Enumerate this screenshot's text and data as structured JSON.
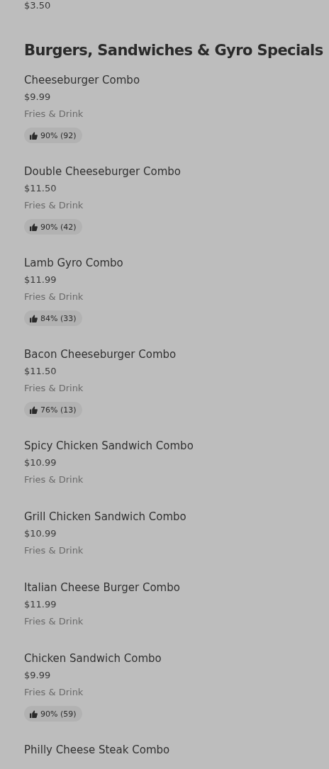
{
  "previous_item": {
    "price": "$3.50"
  },
  "section": {
    "title": "Burgers, Sandwiches & Gyro Specials",
    "items": [
      {
        "name": "Cheeseburger Combo",
        "price": "$9.99",
        "description": "Fries & Drink",
        "rating": "90% (92)"
      },
      {
        "name": "Double Cheeseburger Combo",
        "price": "$11.50",
        "description": "Fries & Drink",
        "rating": "90% (42)"
      },
      {
        "name": "Lamb Gyro Combo",
        "price": "$11.99",
        "description": "Fries & Drink",
        "rating": "84% (33)"
      },
      {
        "name": "Bacon Cheeseburger Combo",
        "price": "$11.50",
        "description": "Fries & Drink",
        "rating": "76% (13)"
      },
      {
        "name": "Spicy Chicken Sandwich Combo",
        "price": "$10.99",
        "description": "Fries & Drink"
      },
      {
        "name": "Grill Chicken Sandwich Combo",
        "price": "$10.99",
        "description": "Fries & Drink"
      },
      {
        "name": "Italian Cheese Burger Combo",
        "price": "$11.99",
        "description": "Fries & Drink"
      },
      {
        "name": "Chicken Sandwich Combo",
        "price": "$9.99",
        "description": "Fries & Drink",
        "rating": "90% (59)"
      },
      {
        "name": "Philly Cheese Steak Combo"
      }
    ]
  }
}
